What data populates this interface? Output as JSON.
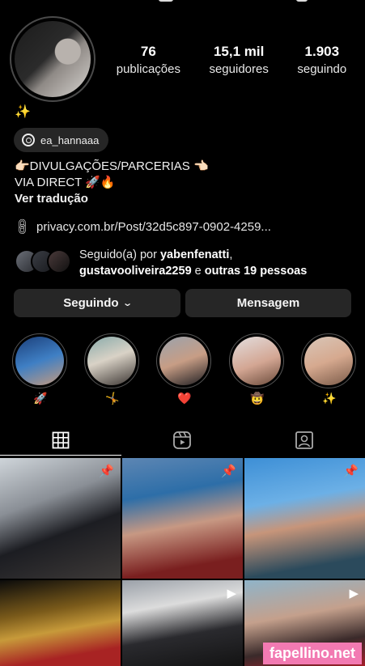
{
  "profile": {
    "stats": [
      {
        "value": "76",
        "label": "publicações"
      },
      {
        "value": "15,1 mil",
        "label": "seguidores"
      },
      {
        "value": "1.903",
        "label": "seguindo"
      }
    ],
    "bio_emoji": "✨",
    "threads_handle": "ea_hannaaa",
    "bio_line1": "👉🏻DIVULGAÇÕES/PARCERIAS 👈🏻",
    "bio_line2": "VIA DIRECT 🚀🔥",
    "translate_label": "Ver tradução",
    "link_text": "privacy.com.br/Post/32d5c897-0902-4259..."
  },
  "mutuals": {
    "prefix": "Seguido(a) por ",
    "user1": "yabenfenatti",
    "user2": "gustavooliveira2259",
    "middle": " e ",
    "others": "outras 19 pessoas"
  },
  "actions": {
    "following_label": "Seguindo",
    "following_chevron": "⌄",
    "message_label": "Mensagem"
  },
  "highlights": [
    {
      "label": "🚀"
    },
    {
      "label": "🤸"
    },
    {
      "label": "❤️"
    },
    {
      "label": "🤠"
    },
    {
      "label": "✨"
    }
  ],
  "tabs": [
    "grid-icon",
    "reels-icon",
    "tagged-icon"
  ],
  "posts": [
    {
      "badge": "📌",
      "icon": "pin-icon"
    },
    {
      "badge": "📌",
      "icon": "pin-icon"
    },
    {
      "badge": "📌",
      "icon": "pin-icon"
    },
    {
      "badge": "",
      "icon": ""
    },
    {
      "badge": "▶",
      "icon": "reels-icon"
    },
    {
      "badge": "▶",
      "icon": "reels-icon"
    }
  ],
  "watermark": "fapellino.net",
  "colors": {
    "background": "#000000",
    "button": "#262626",
    "watermark": "#f27ab2"
  }
}
